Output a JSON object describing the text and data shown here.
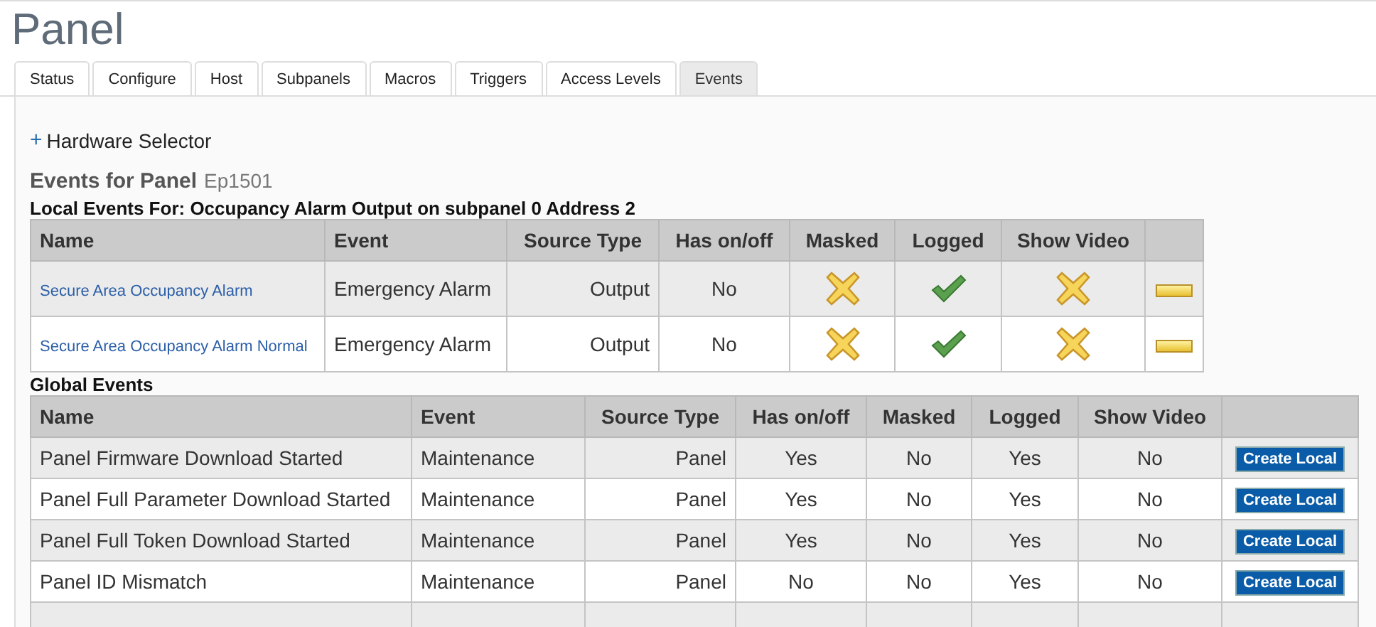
{
  "page_title": "Panel",
  "tabs": [
    {
      "label": "Status",
      "selected": false
    },
    {
      "label": "Configure",
      "selected": false
    },
    {
      "label": "Host",
      "selected": false
    },
    {
      "label": "Subpanels",
      "selected": false
    },
    {
      "label": "Macros",
      "selected": false
    },
    {
      "label": "Triggers",
      "selected": false
    },
    {
      "label": "Access Levels",
      "selected": false
    },
    {
      "label": "Events",
      "selected": true
    }
  ],
  "hardware_selector": {
    "toggle": "+",
    "label": "Hardware Selector"
  },
  "heading": {
    "title": "Events for Panel",
    "subtitle": "Ep1501"
  },
  "local_events": {
    "title": "Local Events For: Occupancy Alarm Output on subpanel 0 Address 2",
    "columns": [
      "Name",
      "Event",
      "Source Type",
      "Has on/off",
      "Masked",
      "Logged",
      "Show Video"
    ],
    "rows": [
      {
        "name": "Secure Area Occupancy Alarm",
        "event": "Emergency Alarm",
        "source_type": "Output",
        "has_on_off": "No",
        "masked": false,
        "logged": true,
        "show_video": false
      },
      {
        "name": "Secure Area Occupancy Alarm Normal",
        "event": "Emergency Alarm",
        "source_type": "Output",
        "has_on_off": "No",
        "masked": false,
        "logged": true,
        "show_video": false
      }
    ]
  },
  "global_events": {
    "title": "Global Events",
    "columns": [
      "Name",
      "Event",
      "Source Type",
      "Has on/off",
      "Masked",
      "Logged",
      "Show Video"
    ],
    "rows": [
      {
        "name": "Panel Firmware Download Started",
        "event": "Maintenance",
        "source_type": "Panel",
        "has_on_off": "Yes",
        "masked": "No",
        "logged": "Yes",
        "show_video": "No",
        "action": "Create Local"
      },
      {
        "name": "Panel Full Parameter Download Started",
        "event": "Maintenance",
        "source_type": "Panel",
        "has_on_off": "Yes",
        "masked": "No",
        "logged": "Yes",
        "show_video": "No",
        "action": "Create Local"
      },
      {
        "name": "Panel Full Token Download Started",
        "event": "Maintenance",
        "source_type": "Panel",
        "has_on_off": "Yes",
        "masked": "No",
        "logged": "Yes",
        "show_video": "No",
        "action": "Create Local"
      },
      {
        "name": "Panel ID Mismatch",
        "event": "Maintenance",
        "source_type": "Panel",
        "has_on_off": "No",
        "masked": "No",
        "logged": "Yes",
        "show_video": "No",
        "action": "Create Local"
      }
    ]
  }
}
